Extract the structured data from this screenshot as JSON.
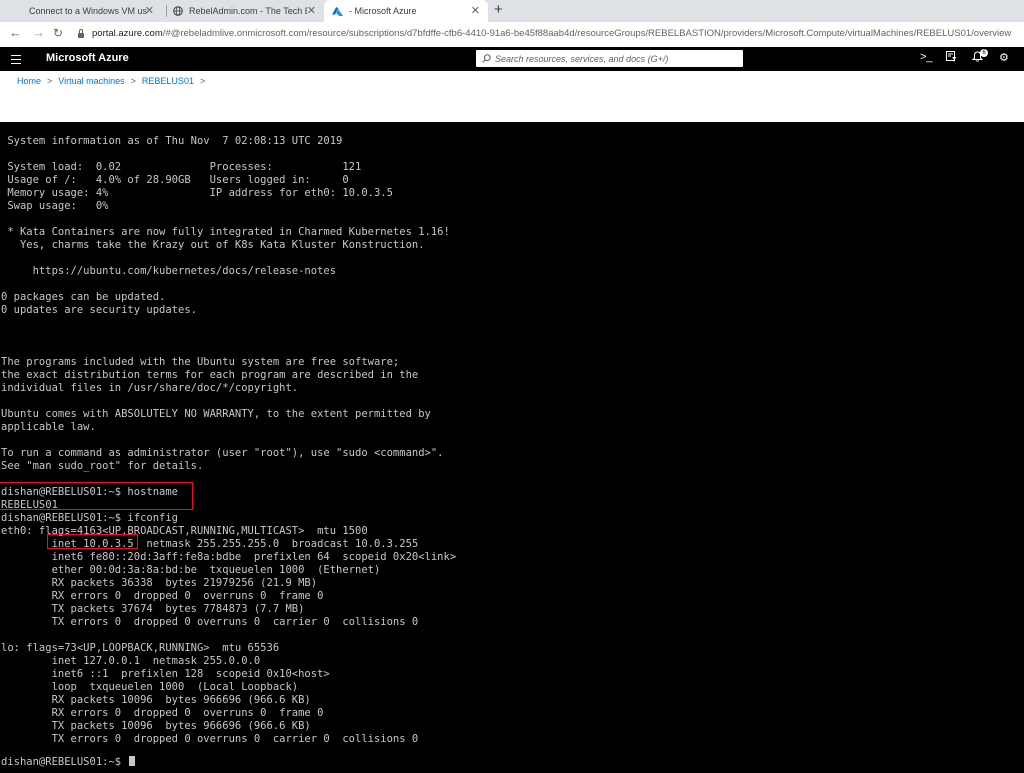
{
  "browser": {
    "tabs": [
      {
        "title": "Connect to a Windows VM using",
        "icon": "windows-logo-icon"
      },
      {
        "title": "RebelAdmin.com - The Tech Blog",
        "icon": "globe-icon"
      },
      {
        "title": "- Microsoft Azure",
        "icon": "azure-logo-icon",
        "active": true
      }
    ],
    "url_host": "portal.azure.com",
    "url_path": "/#@rebeladmlive.onmicrosoft.com/resource/subscriptions/d7bfdffe-cfb6-4410-91a6-be45f88aab4d/resourceGroups/REBELBASTION/providers/Microsoft.Compute/virtualMachines/REBELUS01/overview"
  },
  "portal": {
    "brand": "Microsoft Azure",
    "search_placeholder": "Search resources, services, and docs (G+/)",
    "notification_count": "6",
    "breadcrumbs": [
      "Home",
      "Virtual machines",
      "REBELUS01"
    ]
  },
  "terminal": {
    "lines": [
      "",
      " System information as of Thu Nov  7 02:08:13 UTC 2019",
      "",
      " System load:  0.02              Processes:           121",
      " Usage of /:   4.0% of 28.90GB   Users logged in:     0",
      " Memory usage: 4%                IP address for eth0: 10.0.3.5",
      " Swap usage:   0%",
      "",
      " * Kata Containers are now fully integrated in Charmed Kubernetes 1.16!",
      "   Yes, charms take the Krazy out of K8s Kata Kluster Konstruction.",
      "",
      "     https://ubuntu.com/kubernetes/docs/release-notes",
      "",
      "0 packages can be updated.",
      "0 updates are security updates.",
      "",
      "",
      "",
      "The programs included with the Ubuntu system are free software;",
      "the exact distribution terms for each program are described in the",
      "individual files in /usr/share/doc/*/copyright.",
      "",
      "Ubuntu comes with ABSOLUTELY NO WARRANTY, to the extent permitted by",
      "applicable law.",
      "",
      "To run a command as administrator (user \"root\"), use \"sudo <command>\".",
      "See \"man sudo_root\" for details.",
      "",
      "dishan@REBELUS01:~$ hostname",
      "REBELUS01",
      "dishan@REBELUS01:~$ ifconfig",
      "eth0: flags=4163<UP,BROADCAST,RUNNING,MULTICAST>  mtu 1500",
      "        inet 10.0.3.5  netmask 255.255.255.0  broadcast 10.0.3.255",
      "        inet6 fe80::20d:3aff:fe8a:bdbe  prefixlen 64  scopeid 0x20<link>",
      "        ether 00:0d:3a:8a:bd:be  txqueuelen 1000  (Ethernet)",
      "        RX packets 36338  bytes 21979256 (21.9 MB)",
      "        RX errors 0  dropped 0  overruns 0  frame 0",
      "        TX packets 37674  bytes 7784873 (7.7 MB)",
      "        TX errors 0  dropped 0 overruns 0  carrier 0  collisions 0",
      "",
      "lo: flags=73<UP,LOOPBACK,RUNNING>  mtu 65536",
      "        inet 127.0.0.1  netmask 255.0.0.0",
      "        inet6 ::1  prefixlen 128  scopeid 0x10<host>",
      "        loop  txqueuelen 1000  (Local Loopback)",
      "        RX packets 10096  bytes 966696 (966.6 KB)",
      "        RX errors 0  dropped 0  overruns 0  frame 0",
      "        TX packets 10096  bytes 966696 (966.6 KB)",
      "        TX errors 0  dropped 0 overruns 0  carrier 0  collisions 0",
      "",
      "dishan@REBELUS01:~$ "
    ]
  }
}
